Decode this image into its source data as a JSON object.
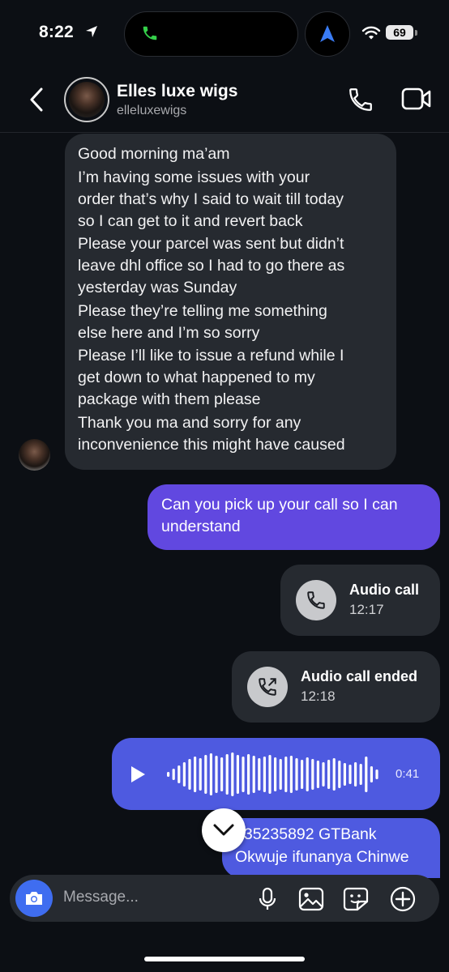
{
  "status_bar": {
    "time": "8:22",
    "battery": "69"
  },
  "header": {
    "name": "Elles luxe wigs",
    "handle": "elleluxewigs"
  },
  "messages": {
    "incoming_1": [
      "Good morning ma’am",
      "I’m having some issues with your",
      "order that’s why I said to wait till today",
      "so I can get to it and revert back",
      "Please your parcel was sent but didn’t",
      "leave dhl office so I had to go there as",
      "yesterday was Sunday",
      "Please they’re telling me something",
      "else here and I’m so sorry",
      "Please I’ll like to issue a refund while I",
      "get down to what happened to my",
      "package with them please",
      "Thank you ma and sorry for any",
      "inconvenience this might have caused"
    ],
    "outgoing_1": [
      "Can you pick up your call so I can",
      "understand"
    ],
    "call_1": {
      "title": "Audio call",
      "time": "12:17"
    },
    "call_2": {
      "title": "Audio call ended",
      "time": "12:18"
    },
    "voice": {
      "duration": "0:41"
    },
    "outgoing_2": [
      "235235892 GTBank",
      "Okwuje ifunanya Chinwe"
    ]
  },
  "composer": {
    "placeholder": "Message..."
  },
  "colors": {
    "outgoing_text": "#6148e0",
    "outgoing_blue": "#4e5ae0",
    "camera": "#3f6df0"
  }
}
